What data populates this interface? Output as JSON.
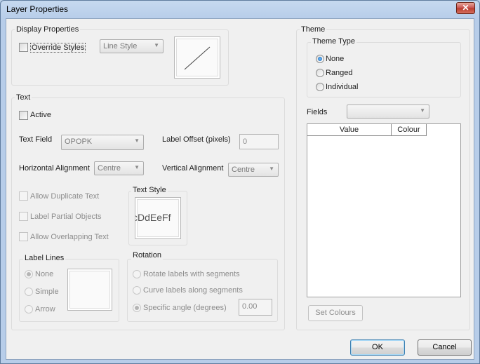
{
  "window": {
    "title": "Layer Properties",
    "close_glyph": "✕"
  },
  "display_properties": {
    "title": "Display Properties",
    "override_styles_label": "Override Styles",
    "line_style_value": "Line Style"
  },
  "text": {
    "title": "Text",
    "active_label": "Active",
    "text_field_label": "Text Field",
    "text_field_value": "OPOPK",
    "label_offset_label": "Label Offset (pixels)",
    "label_offset_value": "0",
    "horizontal_alignment_label": "Horizontal Alignment",
    "horizontal_alignment_value": "Centre",
    "vertical_alignment_label": "Vertical Alignment",
    "vertical_alignment_value": "Centre",
    "allow_duplicate_label": "Allow Duplicate Text",
    "label_partial_label": "Label Partial Objects",
    "allow_overlapping_label": "Allow Overlapping Text",
    "text_style_title": "Text Style",
    "text_style_sample": "cDdEeFf",
    "label_lines": {
      "title": "Label Lines",
      "options": [
        "None",
        "Simple",
        "Arrow"
      ],
      "selected": "None"
    },
    "rotation": {
      "title": "Rotation",
      "options": [
        "Rotate labels with segments",
        "Curve labels along segments",
        "Specific angle (degrees)"
      ],
      "selected": "Specific angle (degrees)",
      "angle_value": "0.00"
    }
  },
  "theme": {
    "title": "Theme",
    "theme_type_title": "Theme Type",
    "options": [
      "None",
      "Ranged",
      "Individual"
    ],
    "selected": "None",
    "fields_label": "Fields",
    "fields_value": "",
    "columns": [
      "Value",
      "Colour"
    ],
    "set_colours_label": "Set Colours"
  },
  "buttons": {
    "ok": "OK",
    "cancel": "Cancel"
  },
  "icons": {
    "dropdown_arrow": "▼",
    "close": "close-icon"
  }
}
